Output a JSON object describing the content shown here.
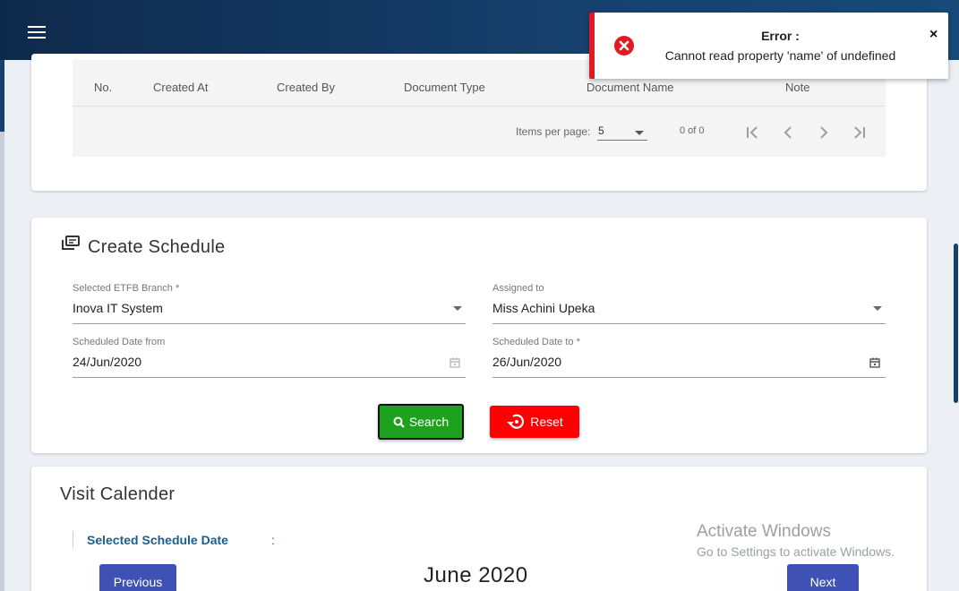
{
  "topbar": {
    "menu_icon": "hamburger-menu-icon"
  },
  "documents_table": {
    "columns": [
      "No.",
      "Created At",
      "Created By",
      "Document Type",
      "Document Name",
      "Note"
    ],
    "paginator": {
      "items_per_page_label": "Items per page:",
      "items_per_page_value": "5",
      "range_label": "0 of 0"
    }
  },
  "create_schedule": {
    "title": "Create Schedule",
    "fields": {
      "branch": {
        "label": "Selected ETFB Branch *",
        "value": "Inova IT System"
      },
      "assigned": {
        "label": "Assigned to",
        "value": "Miss Achini Upeka"
      },
      "date_from": {
        "label": "Scheduled Date from",
        "value": "24/Jun/2020"
      },
      "date_to": {
        "label": "Scheduled Date to *",
        "value": "26/Jun/2020"
      }
    },
    "search_label": "Search",
    "reset_label": "Reset",
    "colors": {
      "search": "#1ea21e",
      "reset": "#ff0000"
    }
  },
  "visit_calendar": {
    "title": "Visit Calender",
    "selected_label": "Selected Schedule Date",
    "selected_separator": ":",
    "month": "June 2020",
    "prev_label": "Previous",
    "next_label": "Next",
    "nav_color": "#3f51b5"
  },
  "toast": {
    "title": "Error :",
    "message": "Cannot read property 'name' of undefined",
    "close": "×",
    "accent": "#e01b24"
  },
  "watermark": {
    "line1": "Activate Windows",
    "line2": "Go to Settings to activate Windows."
  }
}
